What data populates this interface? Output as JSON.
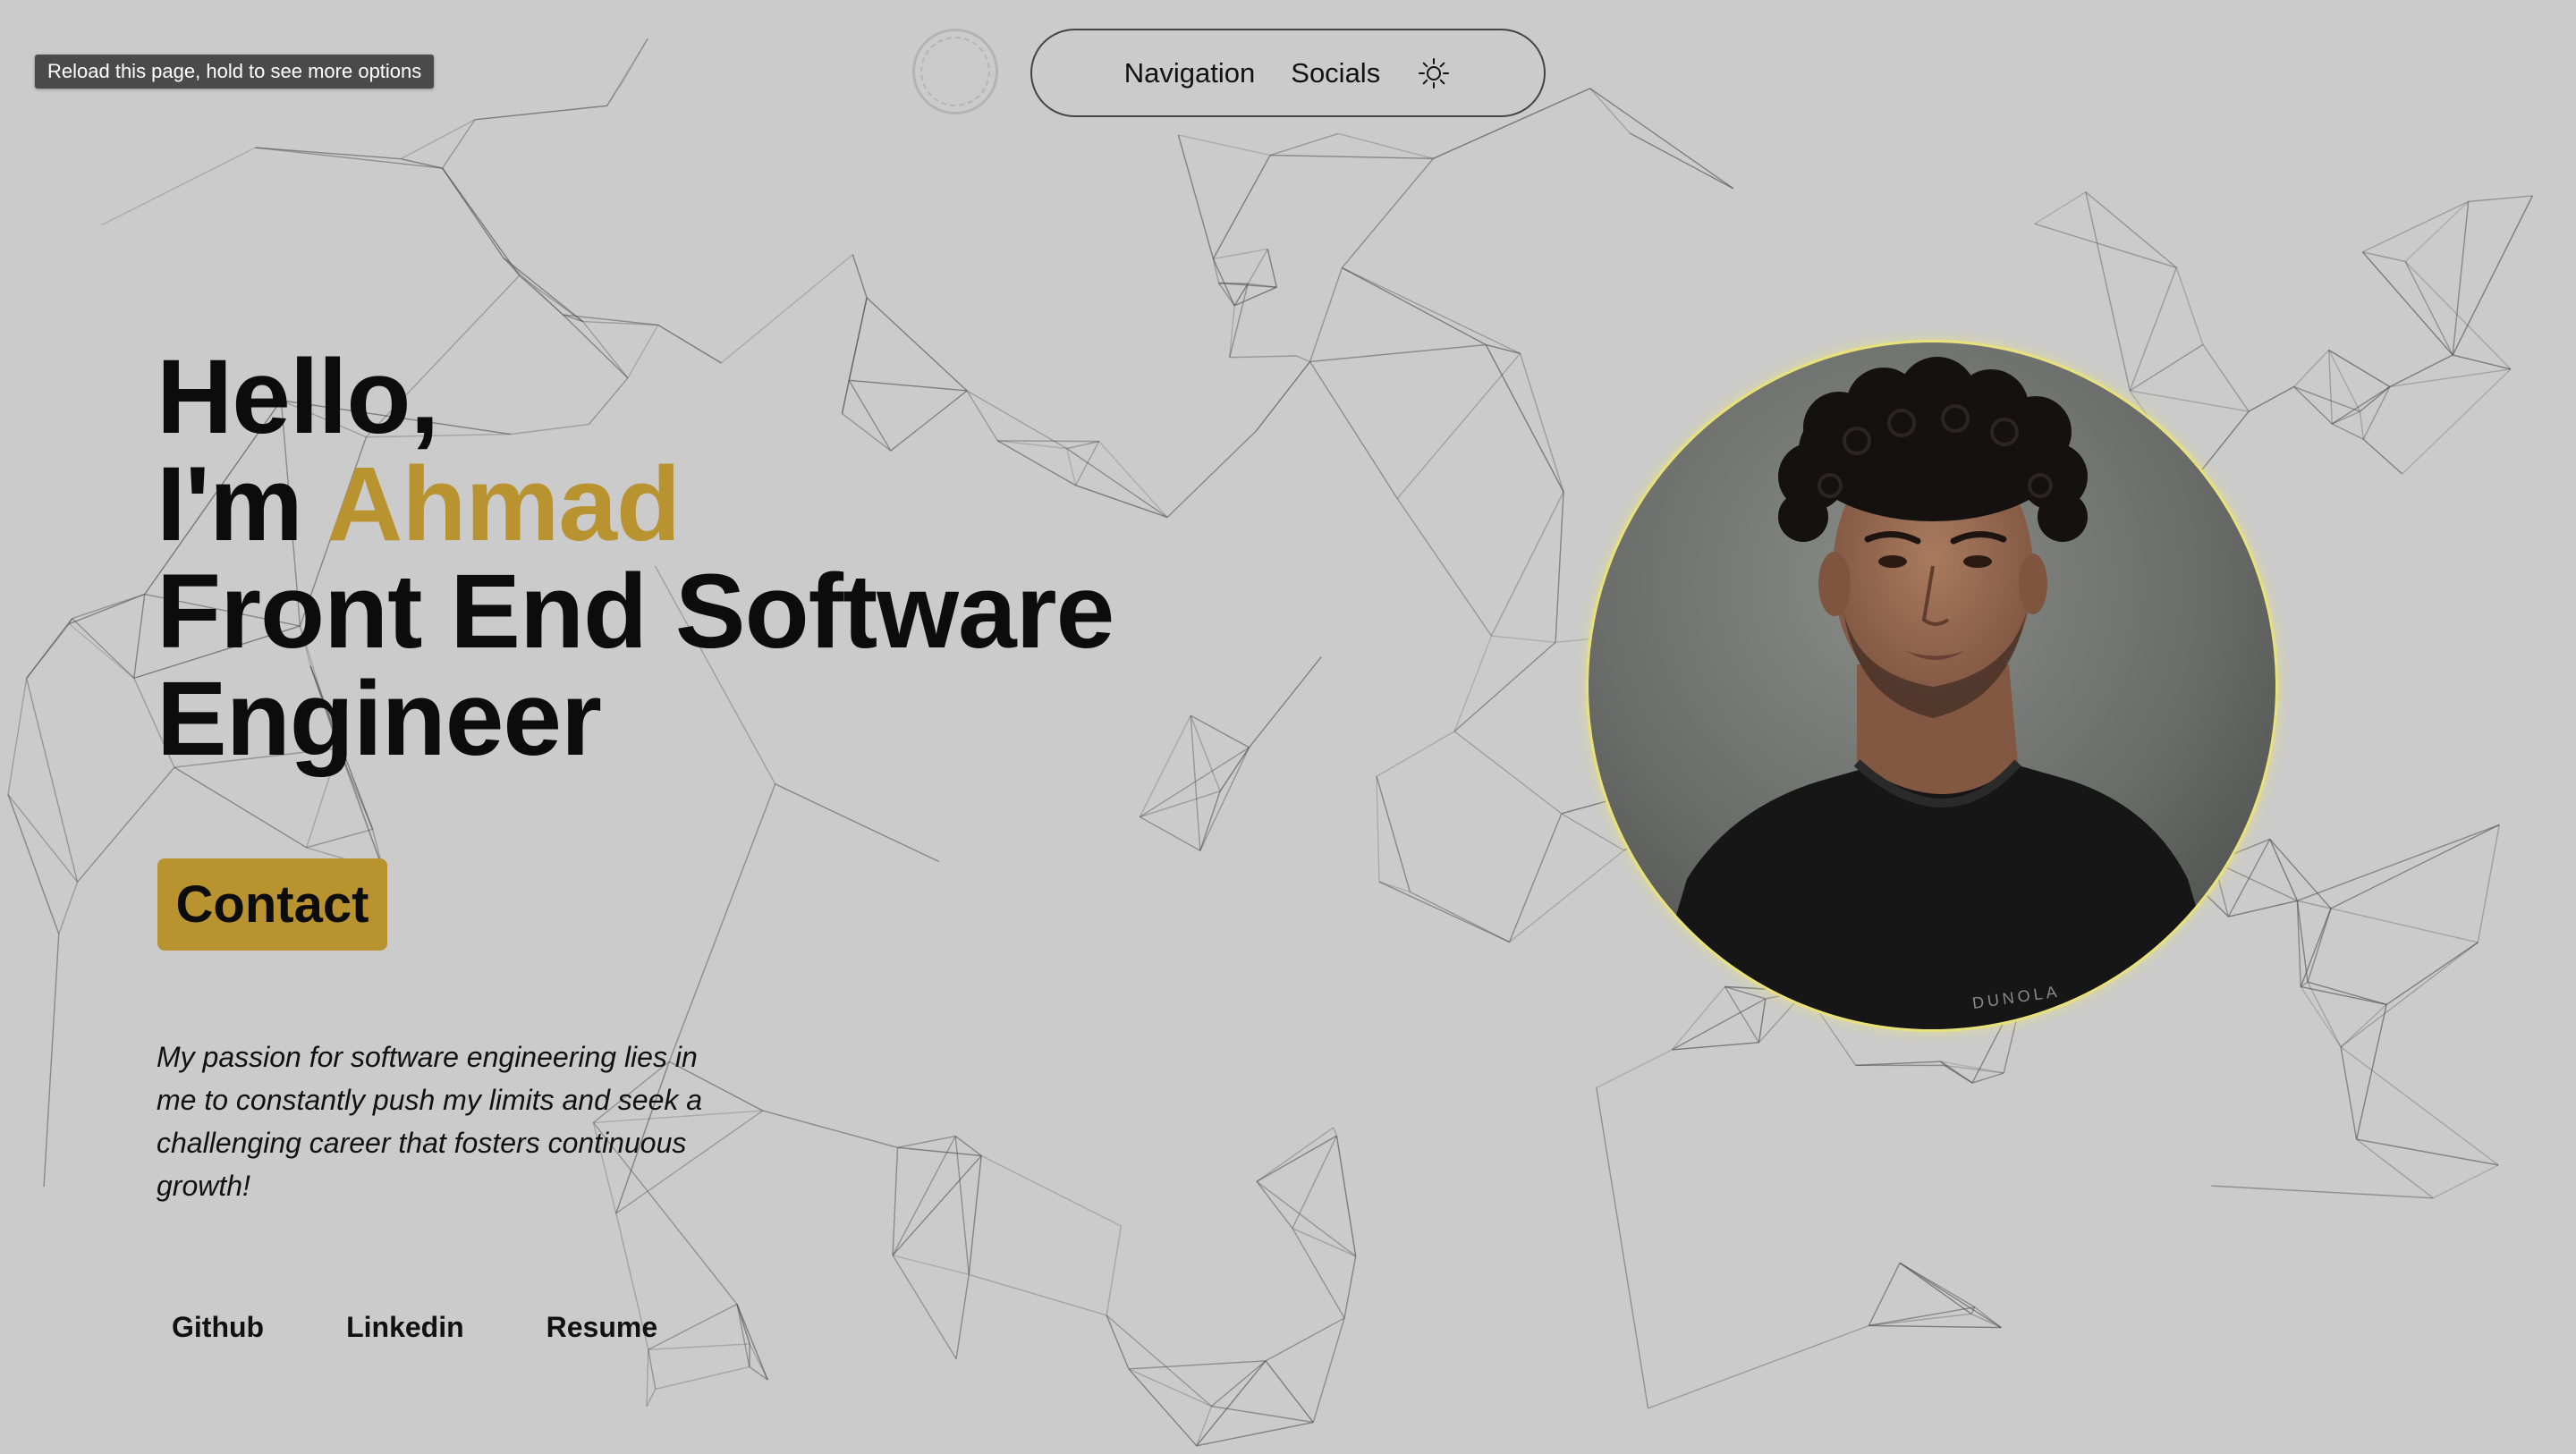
{
  "tooltip": {
    "text": "Reload this page, hold to see more options"
  },
  "nav": {
    "links": [
      "Navigation",
      "Socials"
    ],
    "theme_icon": "sun-icon"
  },
  "hero": {
    "greeting": "Hello,",
    "intro_prefix": "I'm ",
    "name": "Ahmad",
    "role_line1": "Front End Software",
    "role_line2": "Engineer"
  },
  "contact": {
    "label": "Contact"
  },
  "tagline": "My passion for software engineering lies in me to constantly push my limits and seek a challenging career that fosters continuous growth!",
  "socials": [
    "Github",
    "Linkedin",
    "Resume"
  ],
  "portrait": {
    "shirt_text": "DUNOLA"
  },
  "colors": {
    "background": "#cbcbcb",
    "accent": "#b8932f",
    "text": "#0c0c0c",
    "portrait_ring": "#e9e27a"
  }
}
